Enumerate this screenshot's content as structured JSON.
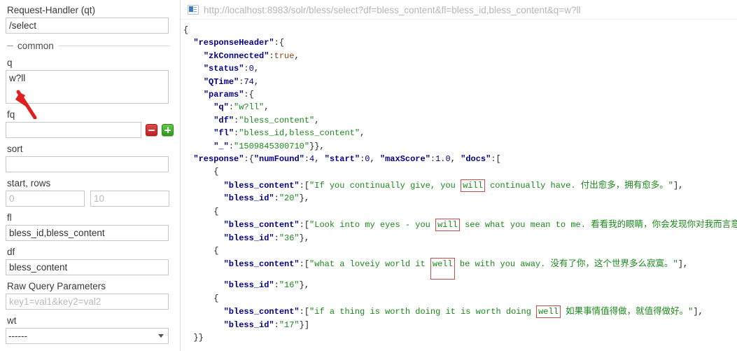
{
  "query_panel": {
    "request_handler_label": "Request-Handler (qt)",
    "request_handler_value": "/select",
    "section_common": "common",
    "fields": {
      "q_label": "q",
      "q_value": "w?ll",
      "fq_label": "fq",
      "fq_value": "",
      "fq_placeholder": "",
      "sort_label": "sort",
      "sort_value": "",
      "start_rows_label": "start, rows",
      "start_placeholder": "0",
      "rows_placeholder": "10",
      "fl_label": "fl",
      "fl_value": "bless_id,bless_content",
      "df_label": "df",
      "df_value": "bless_content",
      "raw_query_label": "Raw Query Parameters",
      "raw_query_placeholder": "key1=val1&key2=val2",
      "wt_label": "wt",
      "wt_value": "------"
    },
    "buttons": {
      "remove_fq": "−",
      "add_fq": "+"
    }
  },
  "result_panel": {
    "url": "http://localhost:8983/solr/bless/select?df=bless_content&fl=bless_id,bless_content&q=w?ll",
    "url_icon": "browser-window-icon"
  },
  "response": {
    "responseHeader": {
      "zkConnected": "true",
      "status": "0",
      "QTime": "74",
      "params": {
        "q": "w?ll",
        "df": "bless_content",
        "fl": "bless_id,bless_content",
        "_": "1509845300710"
      }
    },
    "response_meta": {
      "numFound": "4",
      "start": "0",
      "maxScore": "1.0"
    },
    "docs": [
      {
        "bless_content_pre": "If you continually give, you ",
        "bless_content_hl": "will",
        "bless_content_post": " continually have. ",
        "bless_content_zh": "付出愈多，拥有愈多。",
        "bless_id": "20"
      },
      {
        "bless_content_pre": "Look into my eyes - you ",
        "bless_content_hl": "will",
        "bless_content_post": " see what you mean to me. ",
        "bless_content_zh": "看看我的眼睛，你会发现你对我而言意味着什么。",
        "bless_id": "36"
      },
      {
        "bless_content_pre": "what a loveiy world it ",
        "bless_content_hl": "well",
        "bless_content_post": " be with you away. ",
        "bless_content_zh": "没有了你，这个世界多么寂寞。",
        "bless_id": "16"
      },
      {
        "bless_content_pre": "if a thing is worth doing it is worth doing ",
        "bless_content_hl": "well",
        "bless_content_post": " ",
        "bless_content_zh": "如果事情值得做，就值得做好。",
        "bless_id": "17"
      }
    ]
  },
  "annotations": {
    "q_arrow_color": "#e02020",
    "highlight_box_color": "#c94b4b"
  }
}
